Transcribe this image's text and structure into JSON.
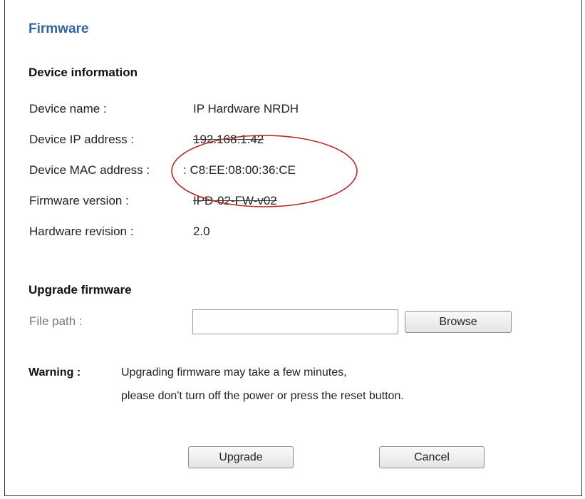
{
  "page": {
    "title": "Firmware"
  },
  "device_info": {
    "heading": "Device information",
    "rows": [
      {
        "label": "Device name :",
        "value": "IP Hardware NRDH"
      },
      {
        "label": "Device IP address :",
        "value": "192.168.1.42"
      },
      {
        "label": "Device MAC address :",
        "value": "C8:EE:08:00:36:CE"
      },
      {
        "label": "Firmware version :",
        "value": "IPD-02-FW-v02"
      },
      {
        "label": "Hardware revision :",
        "value": "2.0"
      }
    ]
  },
  "upgrade": {
    "heading": "Upgrade firmware",
    "file_path_label": "File path :",
    "file_path_value": "",
    "browse_label": "Browse"
  },
  "warning": {
    "label": "Warning :",
    "line1": "Upgrading firmware may take a few minutes,",
    "line2": "please don't turn off the power or press the reset button."
  },
  "actions": {
    "upgrade_label": "Upgrade",
    "cancel_label": "Cancel"
  },
  "colors": {
    "title": "#3263a8",
    "annotation_ellipse": "#b8282d"
  }
}
